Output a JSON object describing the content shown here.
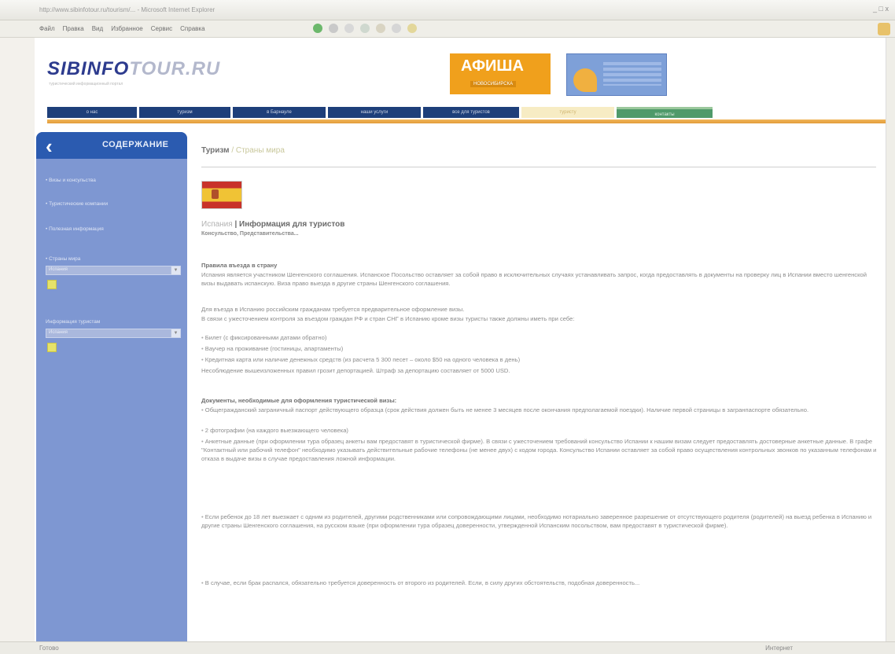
{
  "browser": {
    "window_title": "http://www.sibinfotour.ru/tourism/...  - Microsoft Internet Explorer",
    "window_buttons": "_ □ x",
    "menu": [
      "Файл",
      "Правка",
      "Вид",
      "Избранное",
      "Сервис",
      "Справка"
    ],
    "status_left": "Готово",
    "status_right": "Интернет"
  },
  "header": {
    "logo_part1": "SIBINFO",
    "logo_part2": "TOUR",
    "logo_part3": ".RU",
    "logo_tagline": "туристический информационный портал",
    "afisha_title": "АФИША",
    "afisha_sub": "НОВОСИБИРСКА"
  },
  "nav": {
    "items": [
      "о нас",
      "туризм",
      "в Барнауле",
      "наши услуги",
      "все для туристов",
      "туристу",
      "контакты"
    ]
  },
  "sidebar": {
    "title": "СОДЕРЖАНИЕ",
    "items": [
      "• Визы и консульства",
      "• Туристические компании",
      "• Полезная информация",
      "• Страны мира"
    ],
    "select1": "Испания",
    "rest_label": "Информация туристам",
    "select2": "Испания"
  },
  "main": {
    "breadcrumb_root": "Туризм",
    "breadcrumb_current": " / Страны мира",
    "heading_link": "Испания",
    "heading_bold": " | Информация для туристов",
    "subtitle": "Консульство, Представительства...",
    "section1_title": "Правила въезда в страну",
    "section1_paragraphs": [
      "Испания является участником Шенгенского соглашения. Испанское Посольство оставляет за собой право в исключительных случаях устанавливать запрос, когда предоставлять в документы на проверку лиц в Испании вместо шенгенской визы выдавать испанскую. Виза право выезда в другие страны Шенгенского соглашения.",
      "Для въезда в Испанию российским гражданам требуется предварительное оформление визы.",
      "В связи с ужесточением контроля за въездом граждан РФ и стран СНГ в Испанию кроме визы туристы также должны иметь при себе:"
    ],
    "section1_bullets": [
      "Билет (с фиксированными датами обратно)",
      "Ваучер на проживание (гостиницы, апартаменты)",
      "Кредитная карта или наличие денежных средств (из расчета 5 300 песет – около $50 на одного человека в день)"
    ],
    "section1_note": "Несоблюдение вышеизложенных правил грозит депортацией. Штраф за депортацию составляет от 5000 USD.",
    "section2_title": "Документы, необходимые для оформления туристической визы:",
    "section2_bullets": [
      "Общегражданский заграничный паспорт действующего образца (срок действия должен быть не менее 3 месяцев после окончания предполагаемой поездки). Наличие первой страницы в загранпаспорте обязательно.",
      "2 фотографии (на каждого выезжающего человека)",
      "Анкетные данные (при оформлении тура образец анкеты вам предоставят в туристической фирме). В связи с ужесточением требований консульство Испании к нашим визам следует предоставлять достоверные анкетные данные. В графе \"Контактный или рабочий телефон\" необходимо указывать действительные рабочие телефоны (не менее двух) с кодом города. Консульство Испании оставляет за собой право осуществления контрольных звонков по указанным телефонам и отказа в выдаче визы в случае предоставления ложной информации.",
      "Если ребенок до 18 лет выезжает с одним из родителей, другими родственниками или сопровождающими лицами, необходимо нотариально заверенное разрешение от отсутствующего родителя (родителей) на выезд ребенка в Испанию и другие страны Шенгенского соглашения, на русском языке (при оформлении тура образец доверенности, утвержденной Испанским посольством, вам предоставят в туристической фирме).",
      "В случае, если брак распался, обязательно требуется доверенность от второго из родителей. Если, в силу других обстоятельств, подобная доверенность..."
    ]
  }
}
